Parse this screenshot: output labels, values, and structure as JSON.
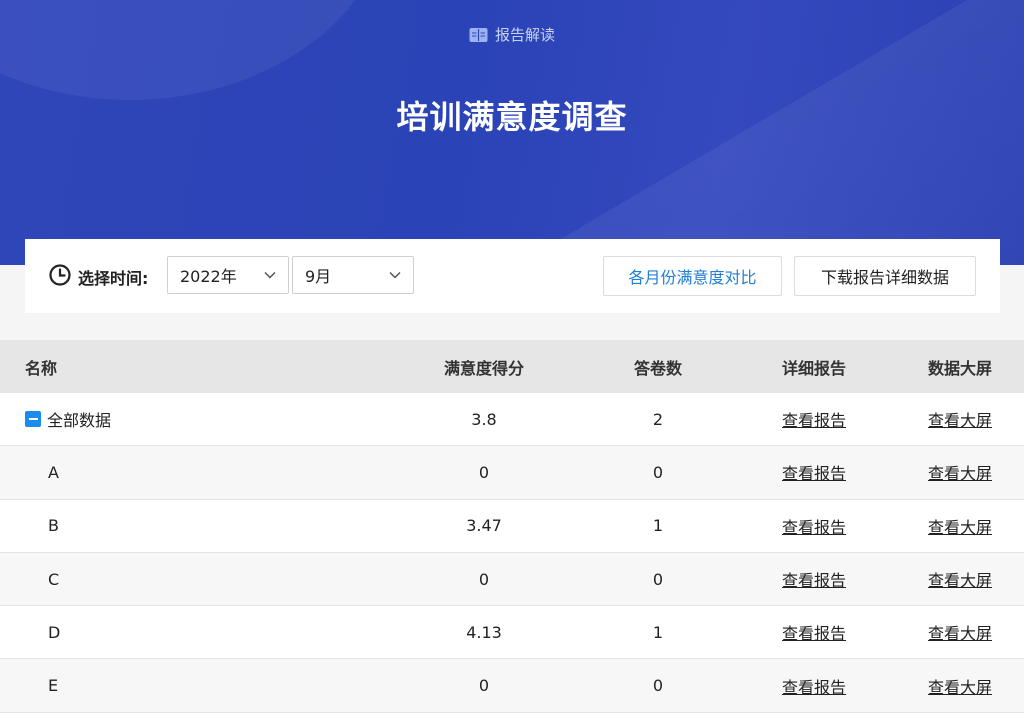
{
  "header": {
    "tag_label": "报告解读",
    "title": "培训满意度调查"
  },
  "toolbar": {
    "time_label": "选择时间:",
    "year_value": "2022年",
    "month_value": "9月",
    "compare_button": "各月份满意度对比",
    "download_button": "下载报告详细数据"
  },
  "table": {
    "columns": [
      "名称",
      "满意度得分",
      "答卷数",
      "详细报告",
      "数据大屏"
    ],
    "rows": [
      {
        "name": "全部数据",
        "score": "3.8",
        "count": "2",
        "detail": "查看报告",
        "screen": "查看大屏"
      },
      {
        "name": "A",
        "score": "0",
        "count": "0",
        "detail": "查看报告",
        "screen": "查看大屏"
      },
      {
        "name": "B",
        "score": "3.47",
        "count": "1",
        "detail": "查看报告",
        "screen": "查看大屏"
      },
      {
        "name": "C",
        "score": "0",
        "count": "0",
        "detail": "查看报告",
        "screen": "查看大屏"
      },
      {
        "name": "D",
        "score": "4.13",
        "count": "1",
        "detail": "查看报告",
        "screen": "查看大屏"
      },
      {
        "name": "E",
        "score": "0",
        "count": "0",
        "detail": "查看报告",
        "screen": "查看大屏"
      }
    ]
  },
  "colors": {
    "hero_blue": "#2f46b8",
    "accent_blue": "#1f7fd6",
    "collapse_blue": "#1a8cf0"
  }
}
